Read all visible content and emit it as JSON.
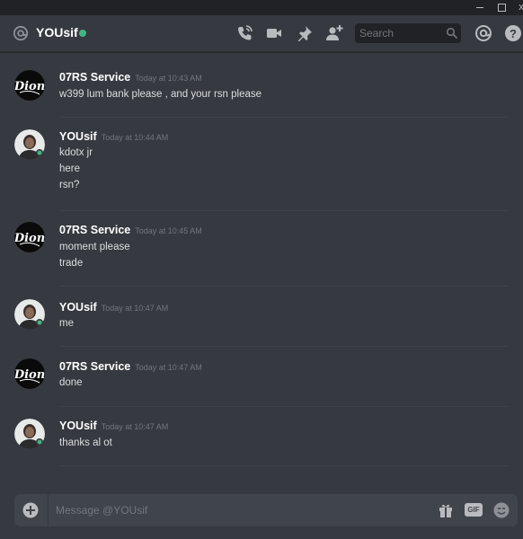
{
  "window": {
    "controls": [
      "minimize",
      "maximize",
      "close"
    ],
    "close_glyph": "x"
  },
  "header": {
    "title": "YOUsif",
    "status": "online",
    "status_color": "#43b581",
    "icons": [
      "at-icon",
      "call-icon",
      "video-icon",
      "pin-icon",
      "add-friend-icon",
      "mention-icon",
      "help-icon"
    ],
    "search_placeholder": "Search"
  },
  "messages": [
    {
      "author": "07RS Service",
      "timestamp": "Today at 10:43 AM",
      "avatar": "dion-logo",
      "lines": [
        "w399 lum bank please , and your rsn please"
      ]
    },
    {
      "author": "YOUsif",
      "timestamp": "Today at 10:44 AM",
      "avatar": "user-photo",
      "lines": [
        "kdotx jr",
        "here",
        "rsn?"
      ]
    },
    {
      "author": "07RS Service",
      "timestamp": "Today at 10:45 AM",
      "avatar": "dion-logo",
      "lines": [
        "moment please",
        "trade"
      ]
    },
    {
      "author": "YOUsif",
      "timestamp": "Today at 10:47 AM",
      "avatar": "user-photo",
      "lines": [
        "me"
      ]
    },
    {
      "author": "07RS Service",
      "timestamp": "Today at 10:47 AM",
      "avatar": "dion-logo",
      "lines": [
        "done"
      ]
    },
    {
      "author": "YOUsif",
      "timestamp": "Today at 10:47 AM",
      "avatar": "user-photo",
      "lines": [
        "thanks al ot"
      ]
    }
  ],
  "composer": {
    "placeholder": "Message @YOUsif",
    "gif_label": "GIF"
  },
  "logo_text": "Dion",
  "colors": {
    "background": "#36393f",
    "titlebar": "#202225",
    "composer": "#40444b",
    "author": "#ffffff",
    "text": "#dcddde",
    "timestamp": "#72767d"
  }
}
